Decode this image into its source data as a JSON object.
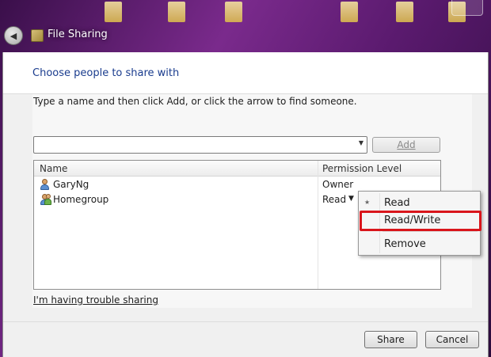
{
  "window": {
    "title": "File Sharing"
  },
  "header": {
    "title": "Choose people to share with"
  },
  "instructions": "Type a name and then click Add, or click the arrow to find someone.",
  "name_input": {
    "value": "",
    "placeholder": ""
  },
  "buttons": {
    "add": "Add",
    "share": "Share",
    "cancel": "Cancel"
  },
  "table": {
    "columns": [
      "Name",
      "Permission Level"
    ],
    "rows": [
      {
        "name": "GaryNg",
        "permission": "Owner",
        "icon": "user-icon"
      },
      {
        "name": "Homegroup",
        "permission": "Read",
        "icon": "homegroup-icon"
      }
    ]
  },
  "context_menu": {
    "items": [
      {
        "label": "Read",
        "checked": true
      },
      {
        "label": "Read/Write",
        "checked": false
      },
      {
        "label": "Remove",
        "checked": false
      }
    ],
    "highlighted": "Read/Write",
    "highlight_color": "#d9151b"
  },
  "links": {
    "trouble": "I'm having trouble sharing"
  },
  "colors": {
    "header_title": "#1a3c8e",
    "dialog_bg": "#f0f0f0"
  }
}
